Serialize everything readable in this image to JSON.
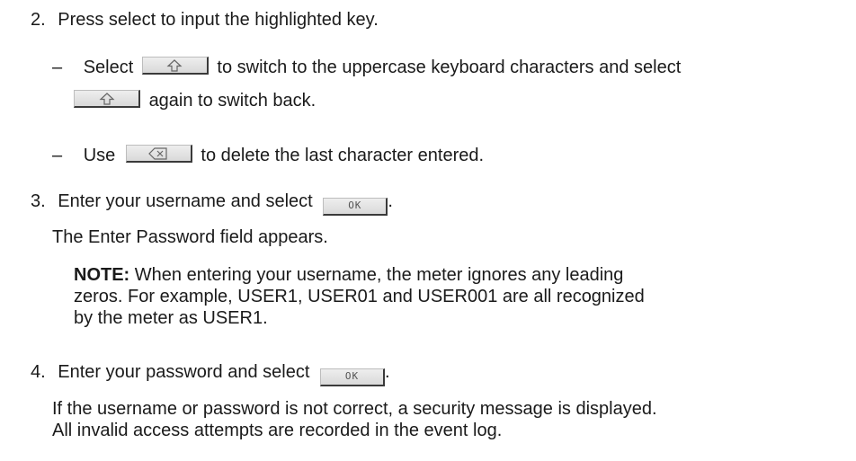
{
  "step2": {
    "number": "2.",
    "text": "Press select to input the highlighted key."
  },
  "bullet_shift": {
    "dash": "–",
    "before": "Select",
    "middle": "to switch to the uppercase keyboard characters and select",
    "after": "again to switch back.",
    "icon": "shift-icon"
  },
  "bullet_delete": {
    "dash": "–",
    "before": "Use",
    "after": "to delete the last character entered.",
    "icon": "backspace-icon"
  },
  "step3": {
    "number": "3.",
    "text": "Enter your username and select",
    "button_label": "OK",
    "end": ".",
    "result": "The Enter Password field appears."
  },
  "note": {
    "label": "NOTE:",
    "line1": "When entering your username, the meter ignores any leading",
    "line2": "zeros. For example, USER1, USER01 and USER001 are all recognized",
    "line3": "by the meter as USER1."
  },
  "step4": {
    "number": "4.",
    "text": "Enter your password and select",
    "button_label": "OK",
    "end": ".",
    "result_line1": "If the username or password is not correct, a security message is displayed.",
    "result_line2": "All invalid access attempts are recorded in the event log."
  }
}
